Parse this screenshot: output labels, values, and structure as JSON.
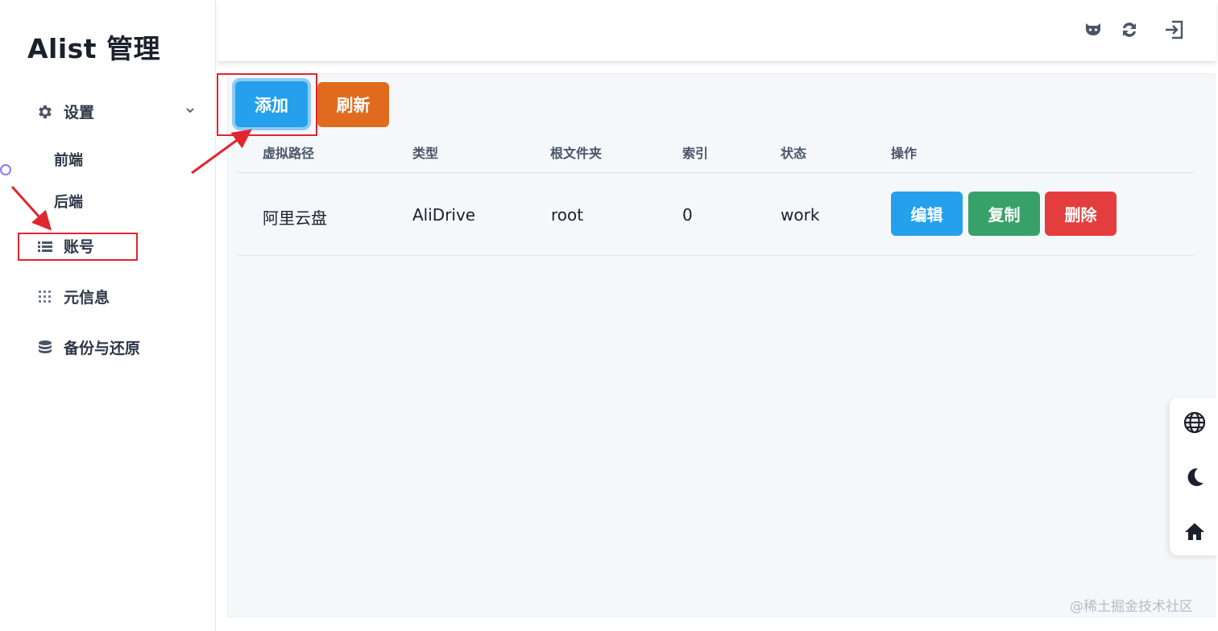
{
  "app": {
    "title": "Alist 管理"
  },
  "sidebar": {
    "items": [
      {
        "label": "设置",
        "icon": "gear-icon",
        "expanded": true,
        "children": [
          {
            "label": "前端"
          },
          {
            "label": "后端"
          }
        ]
      },
      {
        "label": "账号",
        "icon": "list-icon"
      },
      {
        "label": "元信息",
        "icon": "grid-dots-icon"
      },
      {
        "label": "备份与还原",
        "icon": "database-icon"
      }
    ]
  },
  "header": {
    "icons": [
      "github-icon",
      "refresh-icon",
      "logout-icon"
    ]
  },
  "toolbar": {
    "add_label": "添加",
    "refresh_label": "刷新"
  },
  "table": {
    "columns": [
      "虚拟路径",
      "类型",
      "根文件夹",
      "索引",
      "状态",
      "操作"
    ],
    "rows": [
      {
        "path": "阿里云盘",
        "type": "AliDrive",
        "root": "root",
        "index": "0",
        "status": "work",
        "actions": {
          "edit": "编辑",
          "copy": "复制",
          "delete": "删除"
        }
      }
    ]
  },
  "float_panel": {
    "icons": [
      "globe-icon",
      "moon-icon",
      "home-icon"
    ]
  },
  "watermark": "@稀土掘金技术社区",
  "colors": {
    "primary": "#24a0ed",
    "orange": "#e06b1e",
    "green": "#38a169",
    "red": "#e33d3d",
    "annotation": "#e0262f"
  }
}
